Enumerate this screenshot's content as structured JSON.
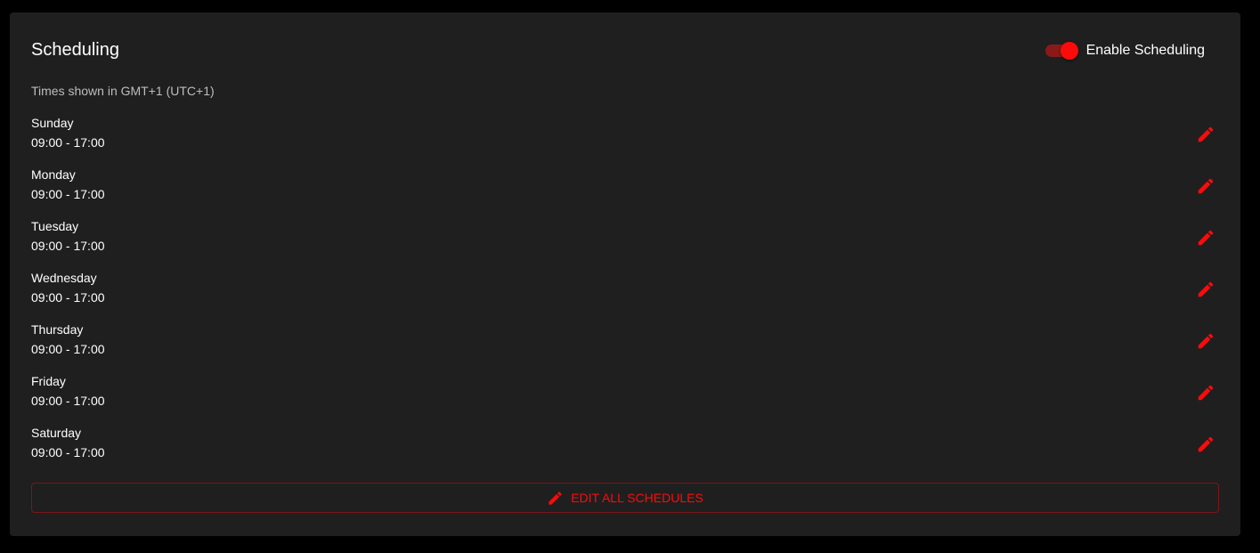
{
  "header": {
    "title": "Scheduling",
    "toggle_label": "Enable Scheduling",
    "toggle_on": true
  },
  "timezone_note": "Times shown in GMT+1 (UTC+1)",
  "days": [
    {
      "name": "Sunday",
      "time": "09:00 - 17:00"
    },
    {
      "name": "Monday",
      "time": "09:00 - 17:00"
    },
    {
      "name": "Tuesday",
      "time": "09:00 - 17:00"
    },
    {
      "name": "Wednesday",
      "time": "09:00 - 17:00"
    },
    {
      "name": "Thursday",
      "time": "09:00 - 17:00"
    },
    {
      "name": "Friday",
      "time": "09:00 - 17:00"
    },
    {
      "name": "Saturday",
      "time": "09:00 - 17:00"
    }
  ],
  "edit_all_label": "EDIT ALL SCHEDULES",
  "icons": {
    "edit": "pencil-icon"
  },
  "colors": {
    "accent": "#ff0a0a",
    "background": "#000000",
    "card": "#1f1f1f"
  }
}
